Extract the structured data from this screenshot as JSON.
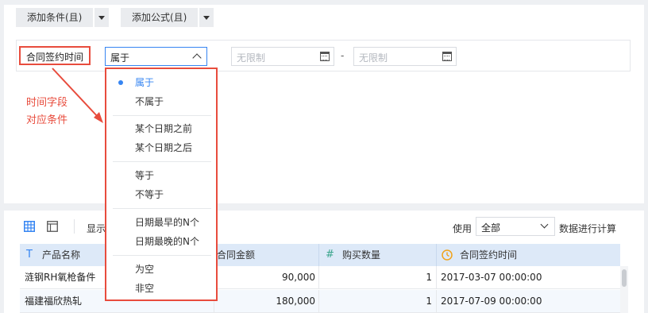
{
  "toolbar": {
    "add_condition": "添加条件(且)",
    "add_formula": "添加公式(且)"
  },
  "filter": {
    "field": "合同签约时间",
    "operator": "属于",
    "date_start_placeholder": "无限制",
    "date_end_placeholder": "无限制",
    "range_separator": "-"
  },
  "dropdown": {
    "items": [
      "属于",
      "不属于",
      "某个日期之前",
      "某个日期之后",
      "等于",
      "不等于",
      "日期最早的N个",
      "日期最晚的N个",
      "为空",
      "非空"
    ],
    "selected": "属于"
  },
  "annotation": {
    "line1": "时间字段",
    "line2": "对应条件"
  },
  "preview": {
    "display_label": "显示",
    "use_label": "使用",
    "use_value": "全部",
    "calc_label": "数据进行计算"
  },
  "table": {
    "headers": [
      "产品名称",
      "合同金额",
      "购买数量",
      "合同签约时间"
    ],
    "header_icons": [
      "text-type-icon",
      "number-type-icon",
      "number-type-icon",
      "date-type-icon"
    ],
    "rows": [
      [
        "涟钢RH氧枪备件",
        "90,000",
        "1",
        "2017-03-07 00:00:00"
      ],
      [
        "福建福欣热轧",
        "180,000",
        "1",
        "2017-07-09 00:00:00"
      ]
    ]
  },
  "colors": {
    "accent": "#3685f2",
    "highlight": "#e84c3d",
    "header_bg": "#dde9f8"
  }
}
